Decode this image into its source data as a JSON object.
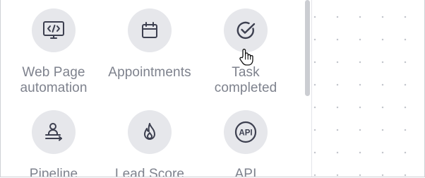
{
  "triggers": [
    {
      "label": "Web Page automation",
      "line1": "Web Page",
      "line2": "automation",
      "icon": "monitor-code-icon"
    },
    {
      "label": "Appointments",
      "line1": "Appointments",
      "line2": "",
      "icon": "calendar-icon"
    },
    {
      "label": "Task completed",
      "line1": "Task",
      "line2": "completed",
      "icon": "check-circle-icon"
    },
    {
      "label": "Pipeline",
      "line1": "Pipeline",
      "line2": "",
      "icon": "pipeline-person-icon"
    },
    {
      "label": "Lead Score",
      "line1": "Lead Score",
      "line2": "",
      "icon": "flame-icon"
    },
    {
      "label": "API",
      "line1": "API",
      "line2": "",
      "icon": "api-icon",
      "icon_text": "API"
    }
  ],
  "colors": {
    "icon_bg": "#e6e7eb",
    "icon_stroke": "#3d4050",
    "label": "#7e828d",
    "scroll_thumb": "#cbcdd2",
    "canvas_dot": "#c3c6cc"
  }
}
